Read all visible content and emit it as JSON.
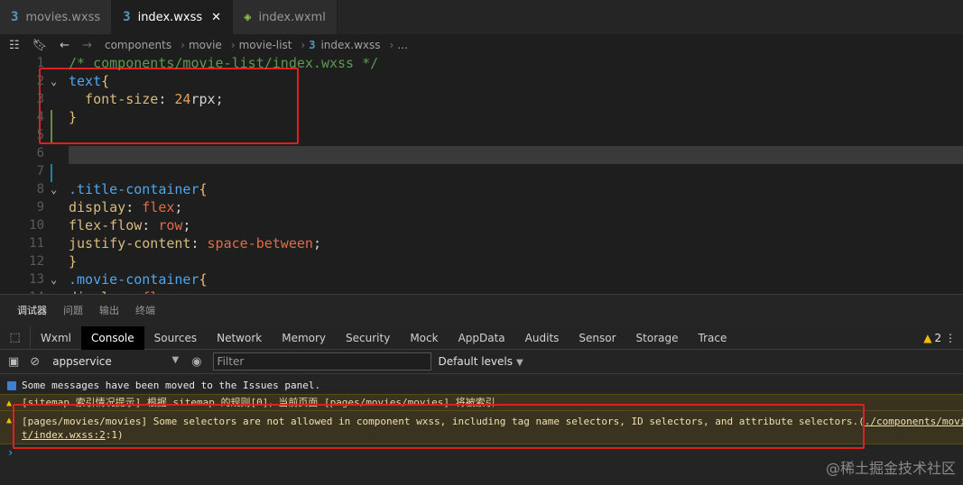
{
  "tabs": [
    {
      "icon": "css-file-icon",
      "glyph": "3",
      "label": "movies.wxss",
      "active": false
    },
    {
      "icon": "css-file-icon",
      "glyph": "3",
      "label": "index.wxss",
      "active": true,
      "close": "✕"
    },
    {
      "icon": "xml-file-icon",
      "glyph": "◈",
      "label": "index.wxml",
      "active": false
    }
  ],
  "breadcrumb": {
    "items": [
      "components",
      "movie",
      "movie-list",
      "index.wxss",
      "..."
    ],
    "separator": "›"
  },
  "editor": {
    "lines": [
      {
        "n": "1",
        "tokens": [
          {
            "t": "/* components/movie-list/index.wxss */",
            "c": "cm"
          }
        ]
      },
      {
        "n": "2",
        "fold": "⌄",
        "tokens": [
          {
            "t": "text",
            "c": "sel"
          },
          {
            "t": "{",
            "c": "brace"
          }
        ]
      },
      {
        "n": "3",
        "tokens": [
          {
            "t": "  font-size",
            "c": "prop"
          },
          {
            "t": ": ",
            "c": "punc"
          },
          {
            "t": "24",
            "c": "num"
          },
          {
            "t": "rpx",
            "c": "unit"
          },
          {
            "t": ";",
            "c": "punc"
          }
        ]
      },
      {
        "n": "4",
        "tokens": [
          {
            "t": "}",
            "c": "brace"
          }
        ]
      },
      {
        "n": "5",
        "tokens": []
      },
      {
        "n": "6",
        "tokens": []
      },
      {
        "n": "7",
        "tokens": []
      },
      {
        "n": "8",
        "fold": "⌄",
        "tokens": [
          {
            "t": ".title-container",
            "c": "sel"
          },
          {
            "t": "{",
            "c": "brace"
          }
        ]
      },
      {
        "n": "9",
        "tokens": [
          {
            "t": "display",
            "c": "prop"
          },
          {
            "t": ": ",
            "c": "punc"
          },
          {
            "t": "flex",
            "c": "val"
          },
          {
            "t": ";",
            "c": "punc"
          }
        ]
      },
      {
        "n": "10",
        "tokens": [
          {
            "t": "flex-flow",
            "c": "prop"
          },
          {
            "t": ": ",
            "c": "punc"
          },
          {
            "t": "row",
            "c": "val"
          },
          {
            "t": ";",
            "c": "punc"
          }
        ]
      },
      {
        "n": "11",
        "tokens": [
          {
            "t": "justify-content",
            "c": "prop"
          },
          {
            "t": ": ",
            "c": "punc"
          },
          {
            "t": "space-between",
            "c": "val"
          },
          {
            "t": ";",
            "c": "punc"
          }
        ]
      },
      {
        "n": "12",
        "tokens": [
          {
            "t": "}",
            "c": "brace"
          }
        ]
      },
      {
        "n": "13",
        "fold": "⌄",
        "tokens": [
          {
            "t": ".movie-container",
            "c": "sel"
          },
          {
            "t": "{",
            "c": "brace"
          }
        ]
      },
      {
        "n": "14",
        "tokens": [
          {
            "t": "display",
            "c": "prop"
          },
          {
            "t": ": ",
            "c": "punc"
          },
          {
            "t": "flex",
            "c": "val"
          },
          {
            "t": ";",
            "c": "punc"
          }
        ]
      }
    ]
  },
  "panel_tabs": [
    "调试器",
    "问题",
    "输出",
    "终端"
  ],
  "devtools": {
    "tabs": [
      "Wxml",
      "Console",
      "Sources",
      "Network",
      "Memory",
      "Security",
      "Mock",
      "AppData",
      "Audits",
      "Sensor",
      "Storage",
      "Trace"
    ],
    "active": "Console",
    "warning_count": "2"
  },
  "filterbar": {
    "context": "appservice",
    "filter_placeholder": "Filter",
    "levels": "Default levels"
  },
  "console": {
    "info": "Some messages have been moved to the Issues panel.",
    "warn1": "[sitemap 索引情况提示] 根据 sitemap 的规则[0]，当前页面 [pages/movies/movies] 将被索引",
    "warn2_text": "[pages/movies/movies] Some selectors are not allowed in component wxss, including tag name selectors, ID selectors, and attribute selectors.(",
    "warn2_link1": "./components/movie-lis",
    "warn2_link2": "t/index.wxss:2",
    "warn2_tail": ":1)",
    "prompt": "›"
  },
  "watermark": "@稀土掘金技术社区",
  "colors": {
    "accent_red": "#e02020",
    "css_icon": "#519aba",
    "xml_icon": "#8dc149",
    "warning": "#f0c000"
  }
}
